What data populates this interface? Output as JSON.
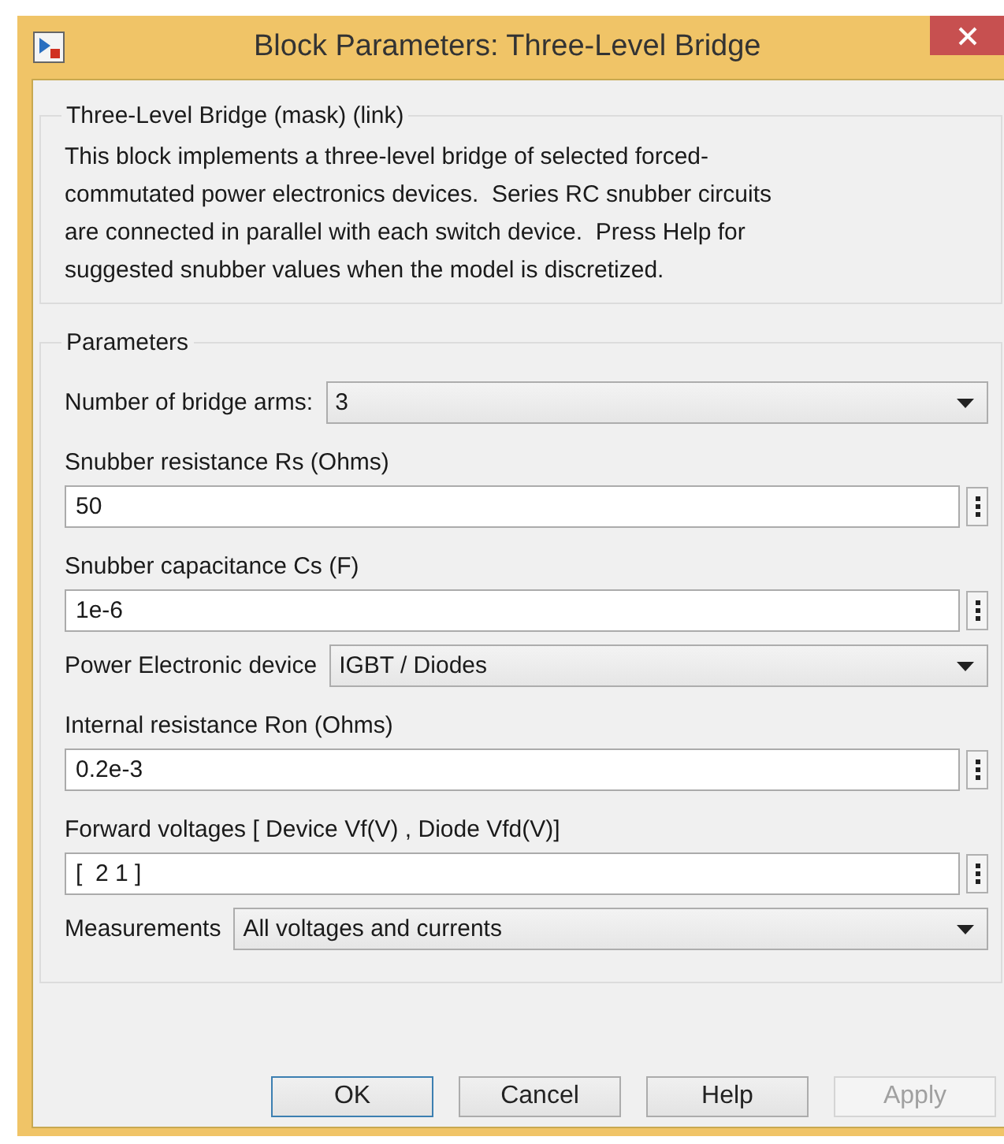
{
  "window": {
    "title": "Block Parameters: Three-Level Bridge"
  },
  "description": {
    "legend": "Three-Level Bridge (mask) (link)",
    "lines": [
      "This block implements a three-level bridge of selected forced-",
      "commutated power electronics devices.  Series RC snubber circuits",
      "are connected in parallel with each switch device.  Press Help for",
      "suggested snubber values when the model is discretized."
    ]
  },
  "parameters": {
    "legend": "Parameters",
    "items": [
      {
        "kind": "dropdown",
        "label": "Number of bridge arms:",
        "value": "3"
      },
      {
        "kind": "edit",
        "label": "Snubber resistance Rs (Ohms)",
        "value": "50"
      },
      {
        "kind": "edit",
        "label": "Snubber capacitance Cs (F)",
        "value": "1e-6"
      },
      {
        "kind": "dropdown",
        "label": "Power Electronic device",
        "value": "IGBT / Diodes"
      },
      {
        "kind": "edit",
        "label": "Internal resistance Ron (Ohms)",
        "value": "0.2e-3"
      },
      {
        "kind": "edit",
        "label": "Forward voltages  [ Device Vf(V) , Diode Vfd(V)]",
        "value": "[  2 1 ]"
      },
      {
        "kind": "dropdown",
        "label": "Measurements",
        "value": "All voltages and currents"
      }
    ]
  },
  "buttons": [
    {
      "label": "OK",
      "default": true,
      "disabled": false
    },
    {
      "label": "Cancel",
      "default": false,
      "disabled": false
    },
    {
      "label": "Help",
      "default": false,
      "disabled": false
    },
    {
      "label": "Apply",
      "default": false,
      "disabled": true
    }
  ]
}
